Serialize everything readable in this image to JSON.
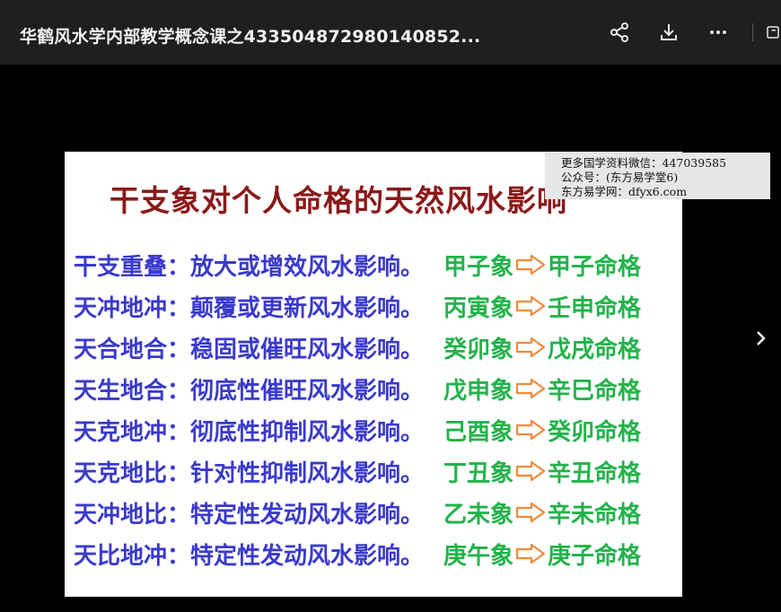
{
  "window": {
    "title": "华鹤风水学内部教学概念课之433504872980140852..."
  },
  "toolbar": {
    "icons": [
      "share-icon",
      "download-icon",
      "more-icon",
      "panel-icon"
    ]
  },
  "slide": {
    "title": "干支象对个人命格的天然风水影响",
    "rows": [
      {
        "left": "干支重叠：放大或增效风水影响。",
        "right1": "甲子象",
        "right2": "甲子命格"
      },
      {
        "left": "天冲地冲：颠覆或更新风水影响。",
        "right1": "丙寅象",
        "right2": "壬申命格"
      },
      {
        "left": "天合地合：稳固或催旺风水影响。",
        "right1": "癸卯象",
        "right2": "戊戌命格"
      },
      {
        "left": "天生地合：彻底性催旺风水影响。",
        "right1": "戊申象",
        "right2": "辛巳命格"
      },
      {
        "left": "天克地冲：彻底性抑制风水影响。",
        "right1": "己酉象",
        "right2": "癸卯命格"
      },
      {
        "left": "天克地比：针对性抑制风水影响。",
        "right1": "丁丑象",
        "right2": "辛丑命格"
      },
      {
        "left": "天冲地比：特定性发动风水影响。",
        "right1": "乙未象",
        "right2": "辛未命格"
      },
      {
        "left": "天比地冲：特定性发动风水影响。",
        "right1": "庚午象",
        "right2": "庚子命格"
      }
    ]
  },
  "watermark": {
    "line1": "更多国学资料微信：447039585",
    "line2": "公众号：(东方易学堂6)",
    "line3": "东方易学网：dfyx6.com"
  },
  "colors": {
    "title_red": "#8b1a1a",
    "left_blue": "#3a3acb",
    "right_green": "#22b34a",
    "arrow_orange": "#f08a3c"
  }
}
